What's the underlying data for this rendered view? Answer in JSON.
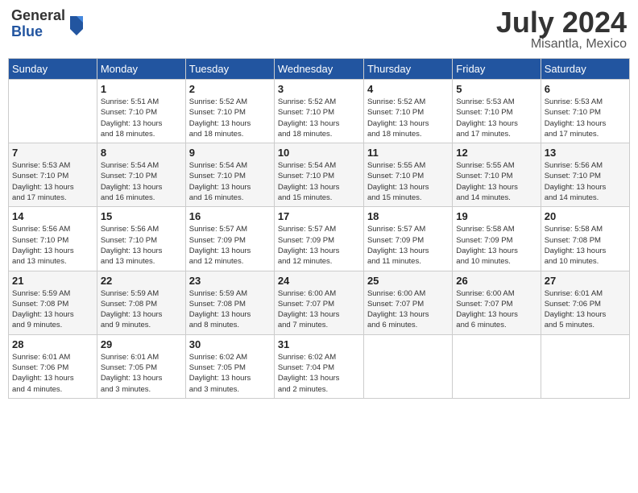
{
  "header": {
    "logo_general": "General",
    "logo_blue": "Blue",
    "month": "July 2024",
    "location": "Misantla, Mexico"
  },
  "weekdays": [
    "Sunday",
    "Monday",
    "Tuesday",
    "Wednesday",
    "Thursday",
    "Friday",
    "Saturday"
  ],
  "weeks": [
    [
      {
        "day": "",
        "info": ""
      },
      {
        "day": "1",
        "info": "Sunrise: 5:51 AM\nSunset: 7:10 PM\nDaylight: 13 hours\nand 18 minutes."
      },
      {
        "day": "2",
        "info": "Sunrise: 5:52 AM\nSunset: 7:10 PM\nDaylight: 13 hours\nand 18 minutes."
      },
      {
        "day": "3",
        "info": "Sunrise: 5:52 AM\nSunset: 7:10 PM\nDaylight: 13 hours\nand 18 minutes."
      },
      {
        "day": "4",
        "info": "Sunrise: 5:52 AM\nSunset: 7:10 PM\nDaylight: 13 hours\nand 18 minutes."
      },
      {
        "day": "5",
        "info": "Sunrise: 5:53 AM\nSunset: 7:10 PM\nDaylight: 13 hours\nand 17 minutes."
      },
      {
        "day": "6",
        "info": "Sunrise: 5:53 AM\nSunset: 7:10 PM\nDaylight: 13 hours\nand 17 minutes."
      }
    ],
    [
      {
        "day": "7",
        "info": "Sunrise: 5:53 AM\nSunset: 7:10 PM\nDaylight: 13 hours\nand 17 minutes."
      },
      {
        "day": "8",
        "info": "Sunrise: 5:54 AM\nSunset: 7:10 PM\nDaylight: 13 hours\nand 16 minutes."
      },
      {
        "day": "9",
        "info": "Sunrise: 5:54 AM\nSunset: 7:10 PM\nDaylight: 13 hours\nand 16 minutes."
      },
      {
        "day": "10",
        "info": "Sunrise: 5:54 AM\nSunset: 7:10 PM\nDaylight: 13 hours\nand 15 minutes."
      },
      {
        "day": "11",
        "info": "Sunrise: 5:55 AM\nSunset: 7:10 PM\nDaylight: 13 hours\nand 15 minutes."
      },
      {
        "day": "12",
        "info": "Sunrise: 5:55 AM\nSunset: 7:10 PM\nDaylight: 13 hours\nand 14 minutes."
      },
      {
        "day": "13",
        "info": "Sunrise: 5:56 AM\nSunset: 7:10 PM\nDaylight: 13 hours\nand 14 minutes."
      }
    ],
    [
      {
        "day": "14",
        "info": "Sunrise: 5:56 AM\nSunset: 7:10 PM\nDaylight: 13 hours\nand 13 minutes."
      },
      {
        "day": "15",
        "info": "Sunrise: 5:56 AM\nSunset: 7:10 PM\nDaylight: 13 hours\nand 13 minutes."
      },
      {
        "day": "16",
        "info": "Sunrise: 5:57 AM\nSunset: 7:09 PM\nDaylight: 13 hours\nand 12 minutes."
      },
      {
        "day": "17",
        "info": "Sunrise: 5:57 AM\nSunset: 7:09 PM\nDaylight: 13 hours\nand 12 minutes."
      },
      {
        "day": "18",
        "info": "Sunrise: 5:57 AM\nSunset: 7:09 PM\nDaylight: 13 hours\nand 11 minutes."
      },
      {
        "day": "19",
        "info": "Sunrise: 5:58 AM\nSunset: 7:09 PM\nDaylight: 13 hours\nand 10 minutes."
      },
      {
        "day": "20",
        "info": "Sunrise: 5:58 AM\nSunset: 7:08 PM\nDaylight: 13 hours\nand 10 minutes."
      }
    ],
    [
      {
        "day": "21",
        "info": "Sunrise: 5:59 AM\nSunset: 7:08 PM\nDaylight: 13 hours\nand 9 minutes."
      },
      {
        "day": "22",
        "info": "Sunrise: 5:59 AM\nSunset: 7:08 PM\nDaylight: 13 hours\nand 9 minutes."
      },
      {
        "day": "23",
        "info": "Sunrise: 5:59 AM\nSunset: 7:08 PM\nDaylight: 13 hours\nand 8 minutes."
      },
      {
        "day": "24",
        "info": "Sunrise: 6:00 AM\nSunset: 7:07 PM\nDaylight: 13 hours\nand 7 minutes."
      },
      {
        "day": "25",
        "info": "Sunrise: 6:00 AM\nSunset: 7:07 PM\nDaylight: 13 hours\nand 6 minutes."
      },
      {
        "day": "26",
        "info": "Sunrise: 6:00 AM\nSunset: 7:07 PM\nDaylight: 13 hours\nand 6 minutes."
      },
      {
        "day": "27",
        "info": "Sunrise: 6:01 AM\nSunset: 7:06 PM\nDaylight: 13 hours\nand 5 minutes."
      }
    ],
    [
      {
        "day": "28",
        "info": "Sunrise: 6:01 AM\nSunset: 7:06 PM\nDaylight: 13 hours\nand 4 minutes."
      },
      {
        "day": "29",
        "info": "Sunrise: 6:01 AM\nSunset: 7:05 PM\nDaylight: 13 hours\nand 3 minutes."
      },
      {
        "day": "30",
        "info": "Sunrise: 6:02 AM\nSunset: 7:05 PM\nDaylight: 13 hours\nand 3 minutes."
      },
      {
        "day": "31",
        "info": "Sunrise: 6:02 AM\nSunset: 7:04 PM\nDaylight: 13 hours\nand 2 minutes."
      },
      {
        "day": "",
        "info": ""
      },
      {
        "day": "",
        "info": ""
      },
      {
        "day": "",
        "info": ""
      }
    ]
  ]
}
